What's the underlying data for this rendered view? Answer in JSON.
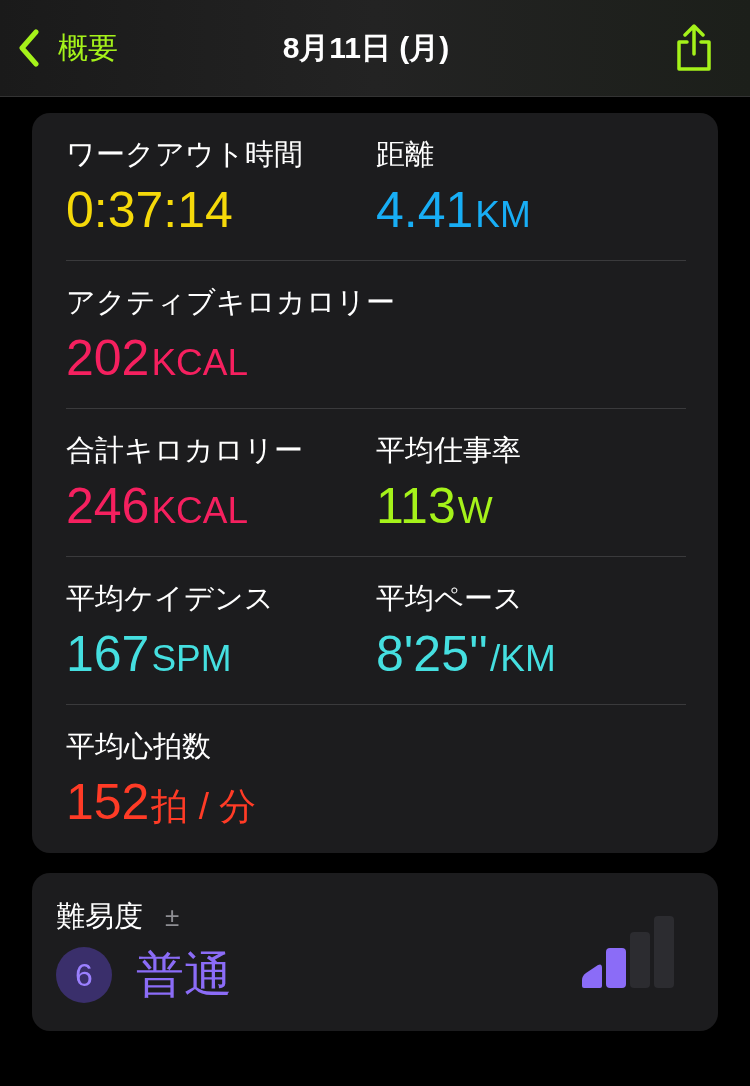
{
  "nav": {
    "back_label": "概要",
    "title": "8月11日 (月)"
  },
  "metrics": [
    [
      {
        "label": "ワークアウト時間",
        "value": "0:37:14",
        "color": "#f5d90a"
      },
      {
        "label": "距離",
        "value": "4.41",
        "unit": "KM",
        "color": "#18aef5"
      }
    ],
    [
      {
        "label": "アクティブキロカロリー",
        "value": "202",
        "unit": "KCAL",
        "color": "#f5205f"
      }
    ],
    [
      {
        "label": "合計キロカロリー",
        "value": "246",
        "unit": "KCAL",
        "color": "#f5205f"
      },
      {
        "label": "平均仕事率",
        "value": "113",
        "unit": "W",
        "color": "#a5f21a"
      }
    ],
    [
      {
        "label": "平均ケイデンス",
        "value": "167",
        "unit": "SPM",
        "color": "#45dfe0"
      },
      {
        "label": "平均ペース",
        "value": "8'25''",
        "unit": "/KM",
        "color": "#45dfe0"
      }
    ],
    [
      {
        "label": "平均心拍数",
        "value": "152",
        "unit": "拍 / 分",
        "color": "#ff3b26"
      }
    ]
  ],
  "effort": {
    "label": "難易度",
    "adjust_mark": "±",
    "score": "6",
    "rating": "普通",
    "meter_bars": [
      {
        "filled": true
      },
      {
        "filled": true
      },
      {
        "filled": false
      },
      {
        "filled": false
      }
    ]
  }
}
